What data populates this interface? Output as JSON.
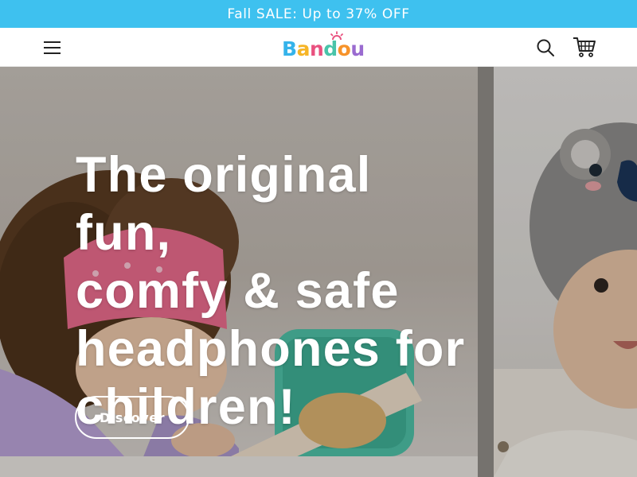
{
  "announcement": {
    "text": "Fall SALE: Up to 37% OFF"
  },
  "header": {
    "menu_icon": "hamburger-menu-icon",
    "logo": {
      "letters": [
        "B",
        "a",
        "n",
        "d",
        "o",
        "u"
      ]
    },
    "search_icon": "search-icon",
    "cart_icon": "cart-icon"
  },
  "hero": {
    "title_lines": [
      "The original fun,",
      "comfy & safe",
      "headphones for",
      "children!"
    ],
    "cta_label": "Discover"
  },
  "colors": {
    "announcement_bg": "#3ec1ef",
    "text_white": "#ffffff",
    "logo": [
      "#35b3ea",
      "#f6b526",
      "#e9517f",
      "#49c4a9",
      "#f7932a",
      "#9a6bd0"
    ]
  }
}
